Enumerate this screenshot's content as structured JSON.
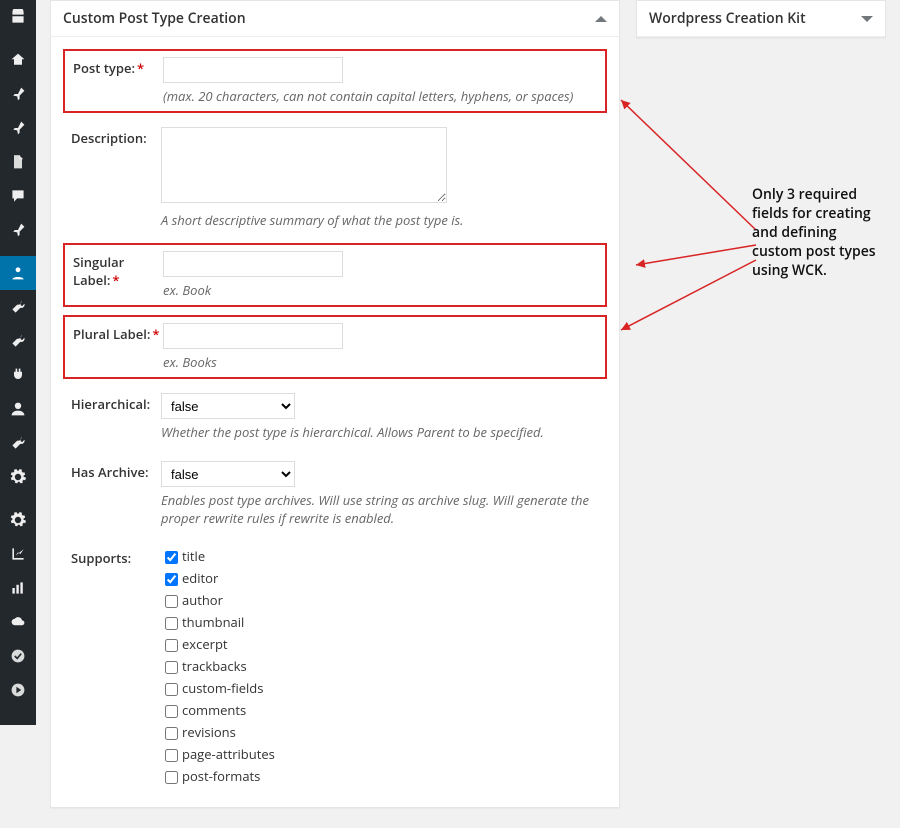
{
  "sidebar_icons": [
    "dashboard",
    "home",
    "pin",
    "pin",
    "page",
    "comment",
    "pin",
    "person",
    "tool",
    "tool",
    "plugin",
    "user",
    "tool",
    "gear",
    "gear",
    "graph",
    "stats",
    "cloud",
    "check",
    "play"
  ],
  "active_sidebar_index": 7,
  "main_panel": {
    "title": "Custom Post Type Creation"
  },
  "side_panel": {
    "title": "Wordpress Creation Kit"
  },
  "fields": {
    "post_type": {
      "label": "Post type:",
      "required": true,
      "hint": "(max. 20 characters, can not contain capital letters, hyphens, or spaces)"
    },
    "description": {
      "label": "Description:",
      "required": false,
      "hint": "A short descriptive summary of what the post type is."
    },
    "singular_label": {
      "label": "Singular Label:",
      "required": true,
      "hint": "ex. Book"
    },
    "plural_label": {
      "label": "Plural Label:",
      "required": true,
      "hint": "ex. Books"
    },
    "hierarchical": {
      "label": "Hierarchical:",
      "value": "false",
      "hint": "Whether the post type is hierarchical. Allows Parent to be specified."
    },
    "has_archive": {
      "label": "Has Archive:",
      "value": "false",
      "hint": "Enables post type archives. Will use string as archive slug. Will generate the proper rewrite rules if rewrite is enabled."
    },
    "supports": {
      "label": "Supports:",
      "options": [
        {
          "name": "title",
          "checked": true
        },
        {
          "name": "editor",
          "checked": true
        },
        {
          "name": "author",
          "checked": false
        },
        {
          "name": "thumbnail",
          "checked": false
        },
        {
          "name": "excerpt",
          "checked": false
        },
        {
          "name": "trackbacks",
          "checked": false
        },
        {
          "name": "custom-fields",
          "checked": false
        },
        {
          "name": "comments",
          "checked": false
        },
        {
          "name": "revisions",
          "checked": false
        },
        {
          "name": "page-attributes",
          "checked": false
        },
        {
          "name": "post-formats",
          "checked": false
        }
      ]
    }
  },
  "annotation": "Only 3 required fields for creating and defining custom post types using WCK."
}
